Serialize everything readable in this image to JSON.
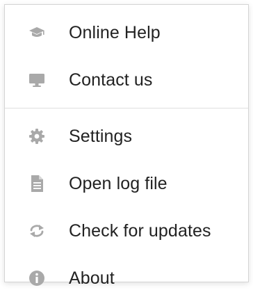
{
  "menu": {
    "icon_color": "#a9a9a9",
    "items": [
      {
        "label": "Online Help",
        "icon": "graduation-cap-icon"
      },
      {
        "label": "Contact us",
        "icon": "monitor-icon"
      },
      {
        "label": "Settings",
        "icon": "gear-icon"
      },
      {
        "label": "Open log file",
        "icon": "document-icon"
      },
      {
        "label": "Check for updates",
        "icon": "refresh-icon"
      },
      {
        "label": "About",
        "icon": "info-icon"
      }
    ]
  }
}
